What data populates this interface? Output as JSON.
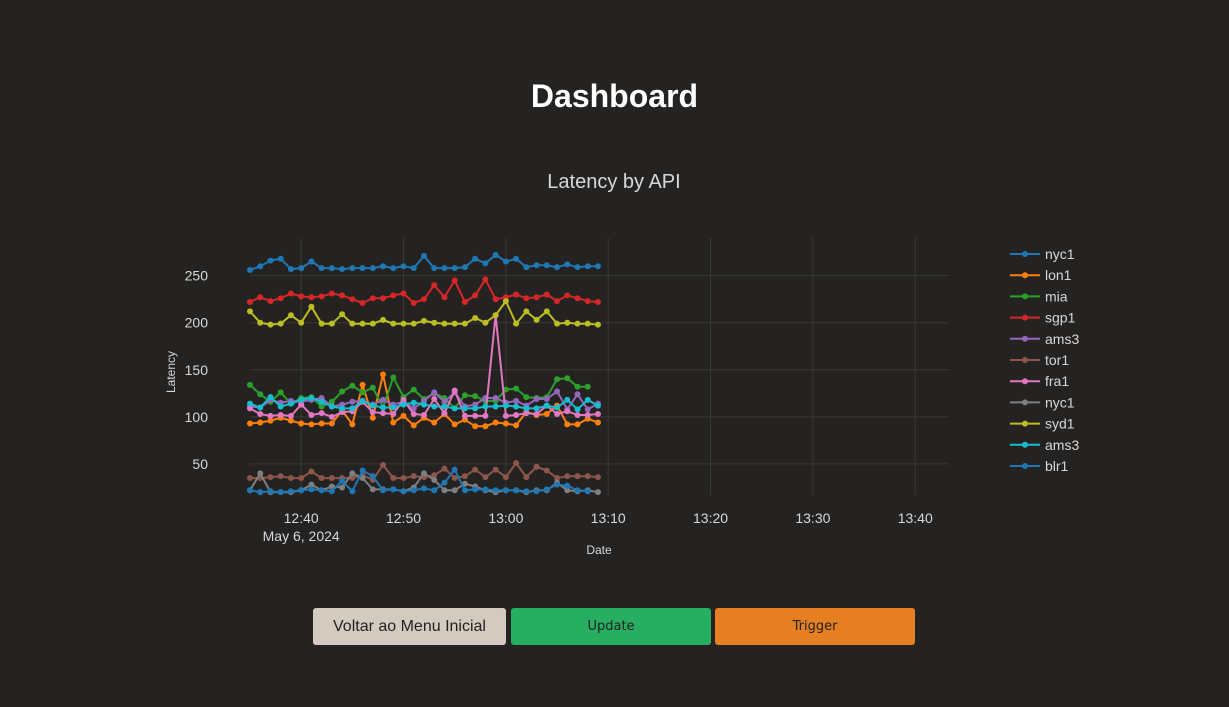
{
  "page": {
    "title": "Dashboard"
  },
  "buttons": {
    "back": "Voltar ao Menu Inicial",
    "update": "Update",
    "trigger": "Trigger"
  },
  "chart_data": {
    "type": "line",
    "title": "Latency by API",
    "xlabel": "Date",
    "ylabel": "Latency",
    "x_start": "2024-05-06 12:35",
    "x_step_minutes": 1,
    "x_ticks": [
      "12:40",
      "12:50",
      "13:00",
      "13:10",
      "13:20",
      "13:30",
      "13:40"
    ],
    "x_tick_minutes": [
      5,
      15,
      25,
      35,
      45,
      55,
      65
    ],
    "x_date_label": "May 6, 2024",
    "x_range_minutes": [
      0,
      68.3
    ],
    "y_ticks": [
      50,
      100,
      150,
      200,
      250
    ],
    "ylim": [
      17,
      290
    ],
    "grid": true,
    "legend_position": "right",
    "series": [
      {
        "name": "nyc1",
        "color": "#1f77b4",
        "values": [
          256,
          260,
          266,
          268,
          257,
          258,
          265,
          258,
          258,
          257,
          258,
          258,
          258,
          260,
          258,
          260,
          258,
          271,
          258,
          258,
          258,
          259,
          268,
          263,
          272,
          265,
          268,
          259,
          261,
          261,
          259,
          262,
          259,
          260,
          260
        ]
      },
      {
        "name": "lon1",
        "color": "#ff7f0e",
        "values": [
          93,
          94,
          96,
          99,
          96,
          93,
          92,
          93,
          93,
          107,
          92,
          134,
          99,
          145,
          94,
          101,
          91,
          99,
          94,
          103,
          92,
          97,
          90,
          90,
          94,
          93,
          91,
          105,
          102,
          103,
          112,
          92,
          92,
          98,
          94
        ]
      },
      {
        "name": "mia",
        "color": "#2ca02c",
        "values": [
          134,
          124,
          116,
          126,
          114,
          120,
          121,
          111,
          116,
          127,
          133,
          126,
          131,
          110,
          142,
          121,
          129,
          119,
          125,
          120,
          109,
          123,
          122,
          117,
          117,
          129,
          130,
          121,
          120,
          121,
          140,
          141,
          132,
          132,
          null
        ]
      },
      {
        "name": "sgp1",
        "color": "#d62728",
        "values": [
          222,
          227,
          223,
          226,
          231,
          228,
          227,
          228,
          231,
          229,
          225,
          221,
          226,
          226,
          229,
          231,
          221,
          225,
          240,
          227,
          245,
          222,
          229,
          246,
          225,
          227,
          230,
          226,
          227,
          230,
          223,
          229,
          226,
          223,
          222
        ]
      },
      {
        "name": "ams3",
        "color": "#9467bd",
        "values": [
          111,
          110,
          118,
          115,
          117,
          116,
          118,
          120,
          111,
          113,
          116,
          117,
          113,
          118,
          113,
          116,
          109,
          117,
          126,
          116,
          126,
          111,
          113,
          120,
          120,
          115,
          117,
          112,
          119,
          119,
          127,
          108,
          124,
          108,
          114
        ]
      },
      {
        "name": "tor1",
        "color": "#8c564b",
        "values": [
          35,
          35,
          36,
          37,
          35,
          35,
          42,
          35,
          35,
          35,
          35,
          38,
          33,
          49,
          35,
          35,
          37,
          36,
          38,
          45,
          35,
          37,
          44,
          36,
          44,
          36,
          51,
          36,
          47,
          43,
          35,
          37,
          37,
          37,
          36
        ]
      },
      {
        "name": "fra1",
        "color": "#e377c2",
        "values": [
          109,
          103,
          101,
          102,
          101,
          113,
          102,
          104,
          100,
          105,
          106,
          116,
          105,
          104,
          103,
          118,
          103,
          102,
          119,
          104,
          128,
          101,
          101,
          101,
          208,
          101,
          102,
          104,
          103,
          112,
          103,
          106,
          102,
          102,
          103
        ]
      },
      {
        "name": "nyc1",
        "color": "#7f7f7f",
        "values": [
          22,
          40,
          20,
          20,
          20,
          22,
          28,
          22,
          26,
          25,
          40,
          35,
          23,
          23,
          23,
          21,
          25,
          40,
          33,
          22,
          22,
          29,
          26,
          22,
          20,
          22,
          22,
          20,
          22,
          22,
          30,
          22,
          21,
          22,
          20
        ]
      },
      {
        "name": "syd1",
        "color": "#bcbd22",
        "values": [
          212,
          200,
          198,
          199,
          208,
          200,
          217,
          199,
          199,
          209,
          199,
          199,
          199,
          203,
          199,
          199,
          199,
          202,
          200,
          199,
          199,
          199,
          205,
          200,
          208,
          223,
          199,
          212,
          203,
          212,
          199,
          200,
          199,
          199,
          198
        ]
      },
      {
        "name": "ams3",
        "color": "#17becf",
        "values": [
          114,
          110,
          121,
          111,
          114,
          118,
          120,
          116,
          111,
          109,
          109,
          117,
          112,
          110,
          110,
          113,
          115,
          113,
          111,
          111,
          109,
          109,
          109,
          111,
          111,
          112,
          111,
          109,
          109,
          112,
          110,
          118,
          108,
          118,
          112
        ]
      },
      {
        "name": "blr1",
        "color": "#1f77b4",
        "values": [
          22,
          20,
          21,
          20,
          21,
          22,
          23,
          22,
          21,
          32,
          21,
          43,
          37,
          22,
          23,
          21,
          22,
          24,
          22,
          30,
          44,
          22,
          23,
          23,
          22,
          22,
          22,
          21,
          21,
          23,
          28,
          27,
          22,
          21,
          null
        ]
      }
    ]
  }
}
